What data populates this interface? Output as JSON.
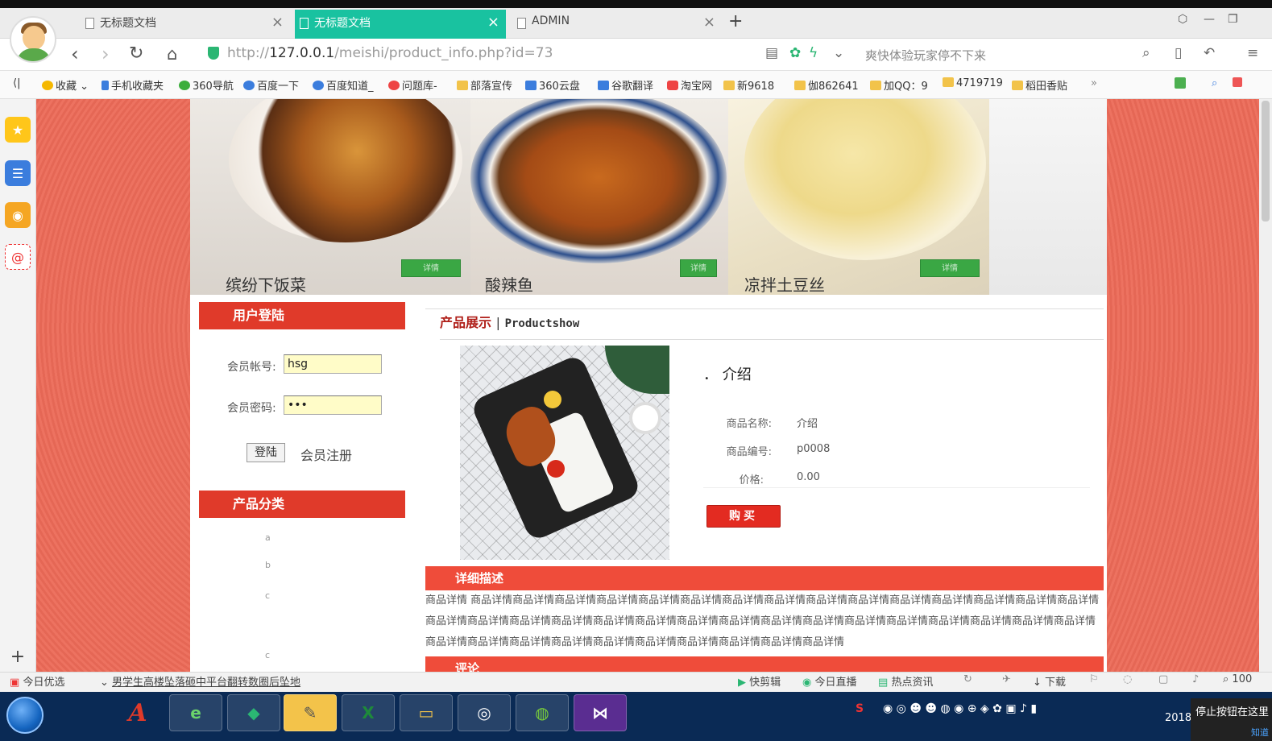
{
  "browser": {
    "tabs": [
      {
        "label": "无标题文档",
        "active": false
      },
      {
        "label": "无标题文档",
        "active": true
      },
      {
        "label": "ADMIN",
        "active": false
      }
    ],
    "new_tab": "+",
    "url_prefix": "http://",
    "url_host": "127.0.0.1",
    "url_path": "/meishi/product_info.php?id=73",
    "search_placeholder": "爽快体验玩家停不下来",
    "bookmarks": [
      {
        "label": "收藏",
        "icon": "star-icon"
      },
      {
        "label": "手机收藏夹",
        "icon": "phone-icon"
      },
      {
        "label": "360导航",
        "icon": "plus-circle-icon"
      },
      {
        "label": "百度一下",
        "icon": "paw-icon"
      },
      {
        "label": "百度知道_",
        "icon": "paw-icon"
      },
      {
        "label": "问题库-",
        "icon": "s-circle-icon"
      },
      {
        "label": "部落宣传",
        "icon": "folder-icon"
      },
      {
        "label": "360云盘",
        "icon": "cloud-icon"
      },
      {
        "label": "谷歌翻译",
        "icon": "translate-icon"
      },
      {
        "label": "淘宝网",
        "icon": "taobao-icon"
      },
      {
        "label": "新9618",
        "icon": "folder-icon"
      },
      {
        "label": "伽862641",
        "icon": "folder-icon"
      },
      {
        "label": "加QQ：9",
        "icon": "folder-icon"
      },
      {
        "label": "4719719",
        "icon": "folder-icon"
      },
      {
        "label": "稻田香贴",
        "icon": "folder-icon"
      }
    ]
  },
  "banner": {
    "dishes": [
      {
        "name": "缤纷下饭菜"
      },
      {
        "name": "酸辣鱼"
      },
      {
        "name": "凉拌土豆丝"
      }
    ],
    "button_label": "详情"
  },
  "login": {
    "title": "用户登陆",
    "account_label": "会员帐号:",
    "account_value": "hsg",
    "password_label": "会员密码:",
    "password_value": "•••",
    "submit_label": "登陆",
    "register_label": "会员注册"
  },
  "categories": {
    "title": "产品分类",
    "items": [
      "a",
      "b",
      "c",
      "c"
    ]
  },
  "product": {
    "crumb_cn": "产品展示",
    "crumb_sep": "|",
    "crumb_en": "Productshow",
    "title": "． 介绍",
    "name_label": "商品名称:",
    "name_value": "介绍",
    "code_label": "商品编号:",
    "code_value": "p0008",
    "price_label": "价格:",
    "price_value": "0.00",
    "buy_label": "购买",
    "detail_title": "详细描述",
    "detail_text": "商品详情 商品详情商品详情商品详情商品详情商品详情商品详情商品详情商品详情商品详情商品详情商品详情商品详情商品详情商品详情商品详情商品详情商品详情商品详情商品详情商品详情商品详情商品详情商品详情商品详情商品详情商品详情商品详情商品详情商品详情商品详情商品详情商品详情商品详情商品详情商品详情商品详情商品详情商品详情商品详情商品详情商品详情",
    "review_title": "评论"
  },
  "statusbar": {
    "left": "今日优选",
    "news": "男学生高楼坠落砸中平台翻转数圈后坠地",
    "items": [
      "快剪辑",
      "今日直播",
      "热点资讯",
      "下载"
    ],
    "zoom": "100"
  },
  "taskbar": {
    "clock": "2018",
    "popup_text": "停止按钮在这里",
    "popup_sub": "知道"
  },
  "colors": {
    "tab_active": "#19c2a0",
    "page_bg": "#ec6a58",
    "red_bar": "#e03a2a",
    "buy": "#e32b21"
  }
}
